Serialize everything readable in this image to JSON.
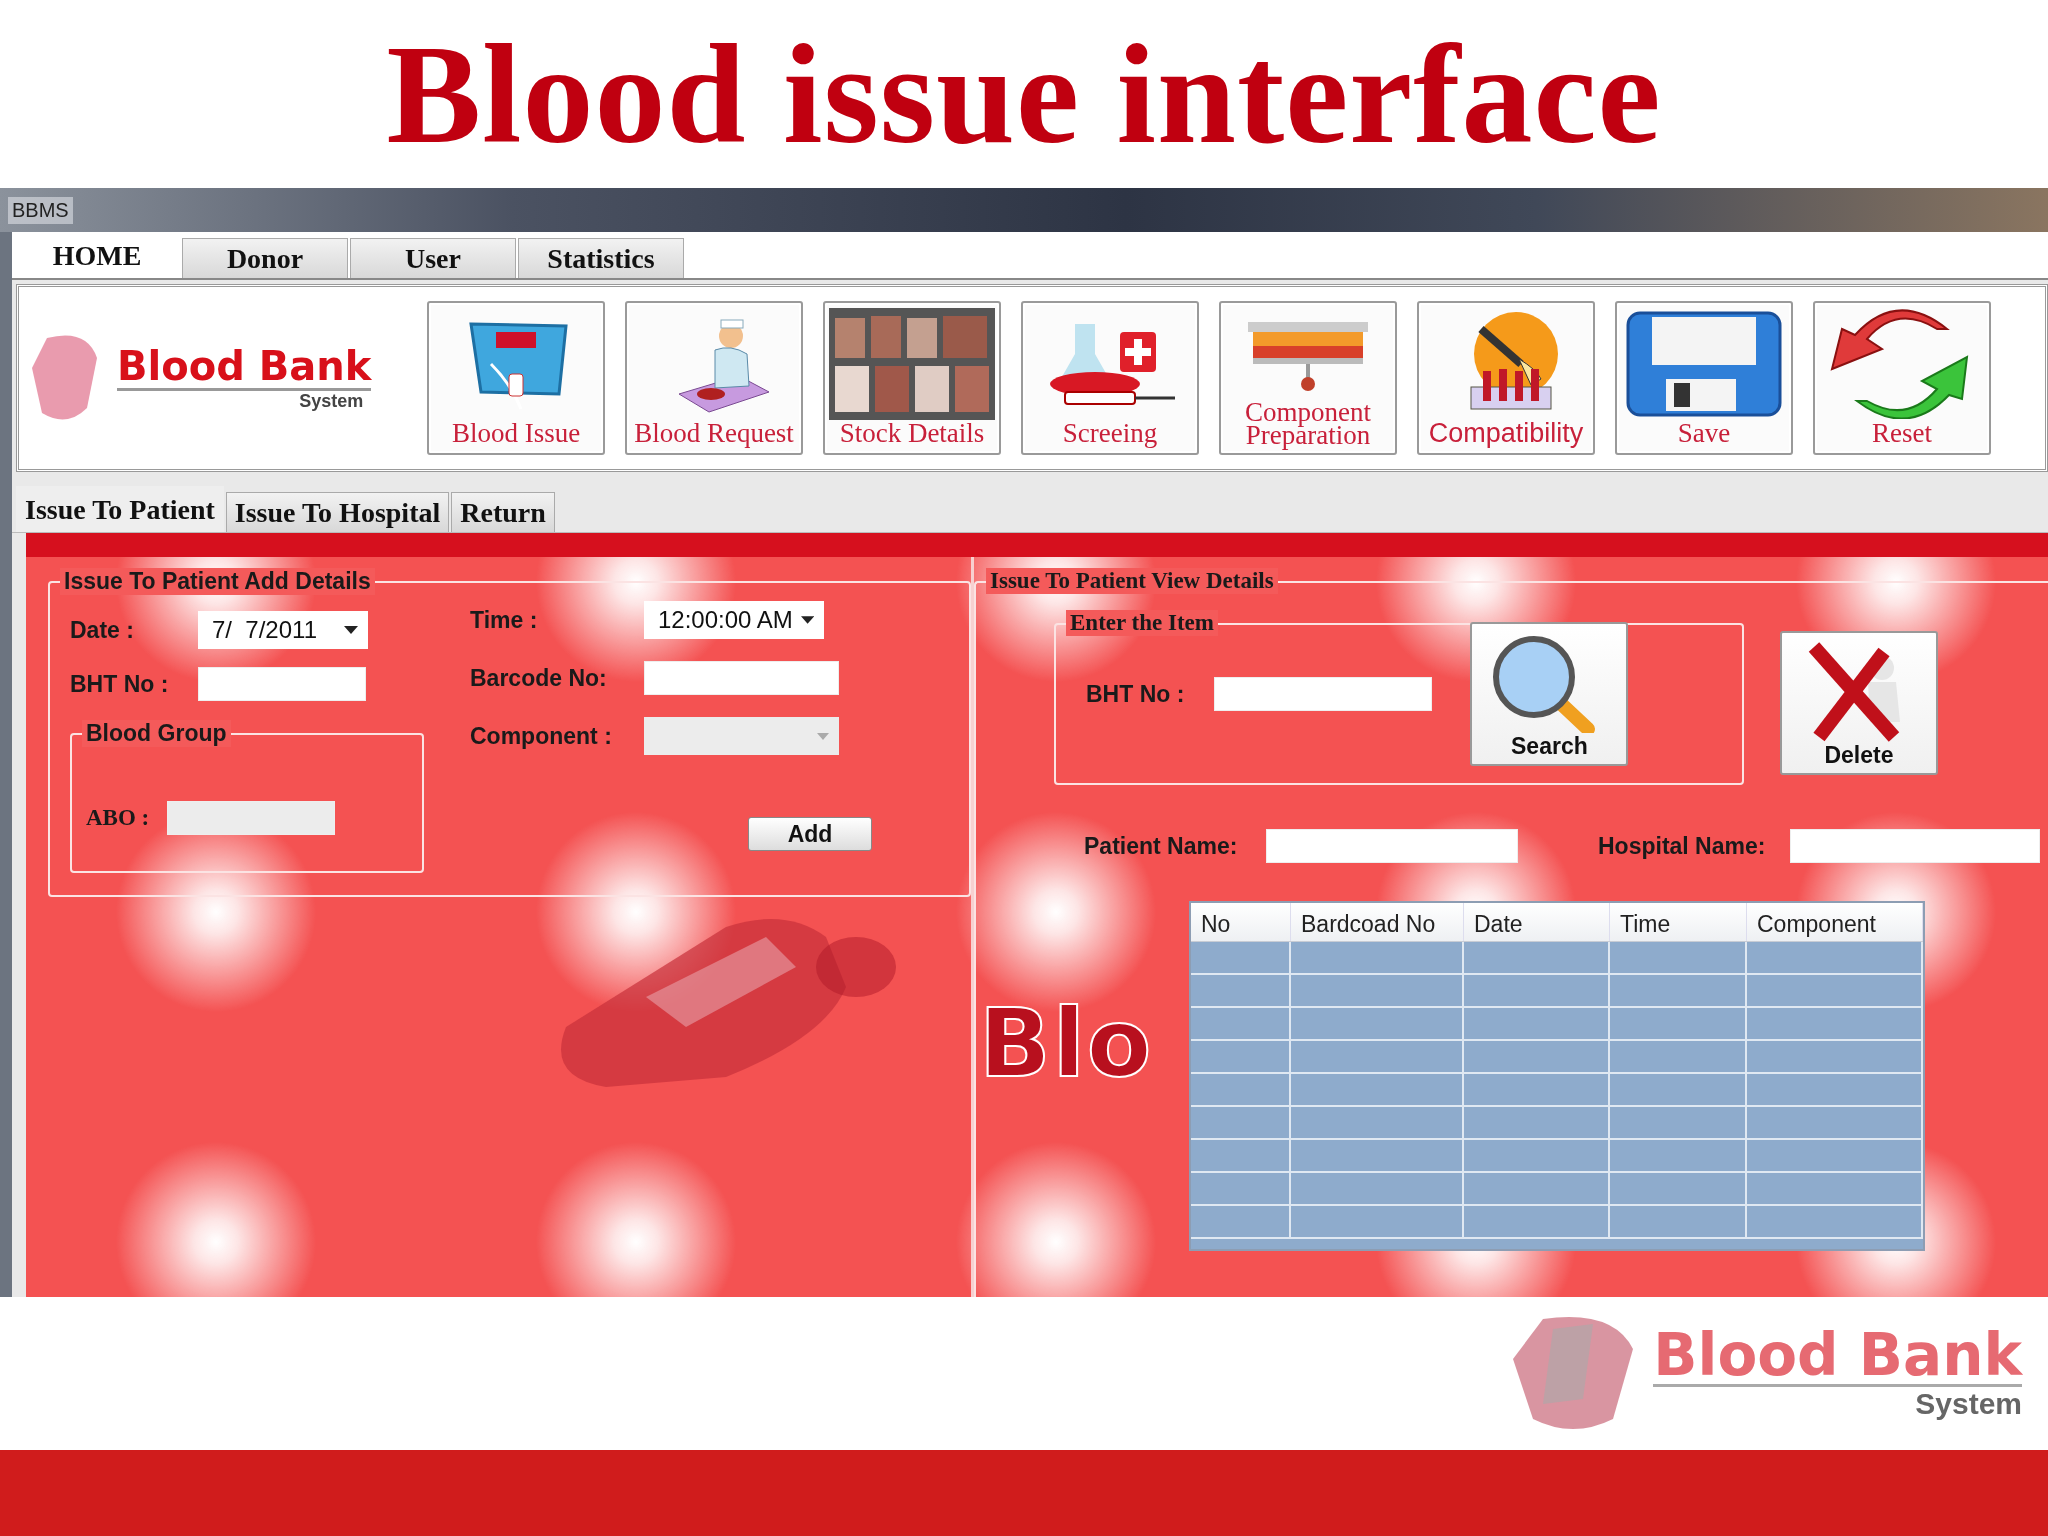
{
  "slide_title": "Blood issue interface",
  "window": {
    "title": "BBMS"
  },
  "main_tabs": [
    {
      "label": "HOME",
      "selected": true
    },
    {
      "label": "Donor",
      "selected": false
    },
    {
      "label": "User",
      "selected": false
    },
    {
      "label": "Statistics",
      "selected": false
    }
  ],
  "logo": {
    "title": "Blood Bank",
    "subtitle": "System"
  },
  "toolbar": [
    {
      "label": "Blood Issue",
      "kind": "monitor"
    },
    {
      "label": "Blood Request",
      "kind": "nurse"
    },
    {
      "label": "Stock Details",
      "kind": "stock"
    },
    {
      "label": "Screeing",
      "kind": "screening"
    },
    {
      "label": "Component Preparation",
      "kind": "component"
    },
    {
      "label": "Compatibility",
      "kind": "tubes"
    },
    {
      "label": "Save",
      "kind": "save"
    },
    {
      "label": "Reset",
      "kind": "reset"
    }
  ],
  "sub_tabs": [
    {
      "label": "Issue To Patient",
      "selected": true
    },
    {
      "label": "Issue To Hospital",
      "selected": false
    },
    {
      "label": "Return",
      "selected": false
    }
  ],
  "add_details": {
    "title": "Issue To Patient Add Details",
    "date": {
      "label": "Date :",
      "value": "7/  7/2011"
    },
    "bht": {
      "label": "BHT No :",
      "disabled": false
    },
    "blood_group": {
      "title": "Blood Group",
      "abo": {
        "label": "ABO :",
        "disabled": true
      }
    },
    "time": {
      "label": "Time :",
      "value": "12:00:00 AM"
    },
    "barcode": {
      "label": "Barcode No:",
      "disabled": false
    },
    "component": {
      "label": "Component :",
      "disabled": true
    },
    "add_button": "Add"
  },
  "background_text": "Blo",
  "view_details": {
    "title": "Issue To Patient View Details",
    "search_group": {
      "title": "Enter the Item",
      "bht": {
        "label": "BHT No :",
        "disabled": false
      }
    },
    "search_button": "Search",
    "delete_button": "Delete",
    "patient_name": {
      "label": "Patient Name:",
      "disabled": false
    },
    "hospital_name": {
      "label": "Hospital Name:",
      "disabled": false
    },
    "table": {
      "columns": [
        "No",
        "Bardcoad No",
        "Date",
        "Time",
        "Component"
      ]
    }
  },
  "footer_logo": {
    "title": "Blood Bank",
    "subtitle": "System"
  }
}
